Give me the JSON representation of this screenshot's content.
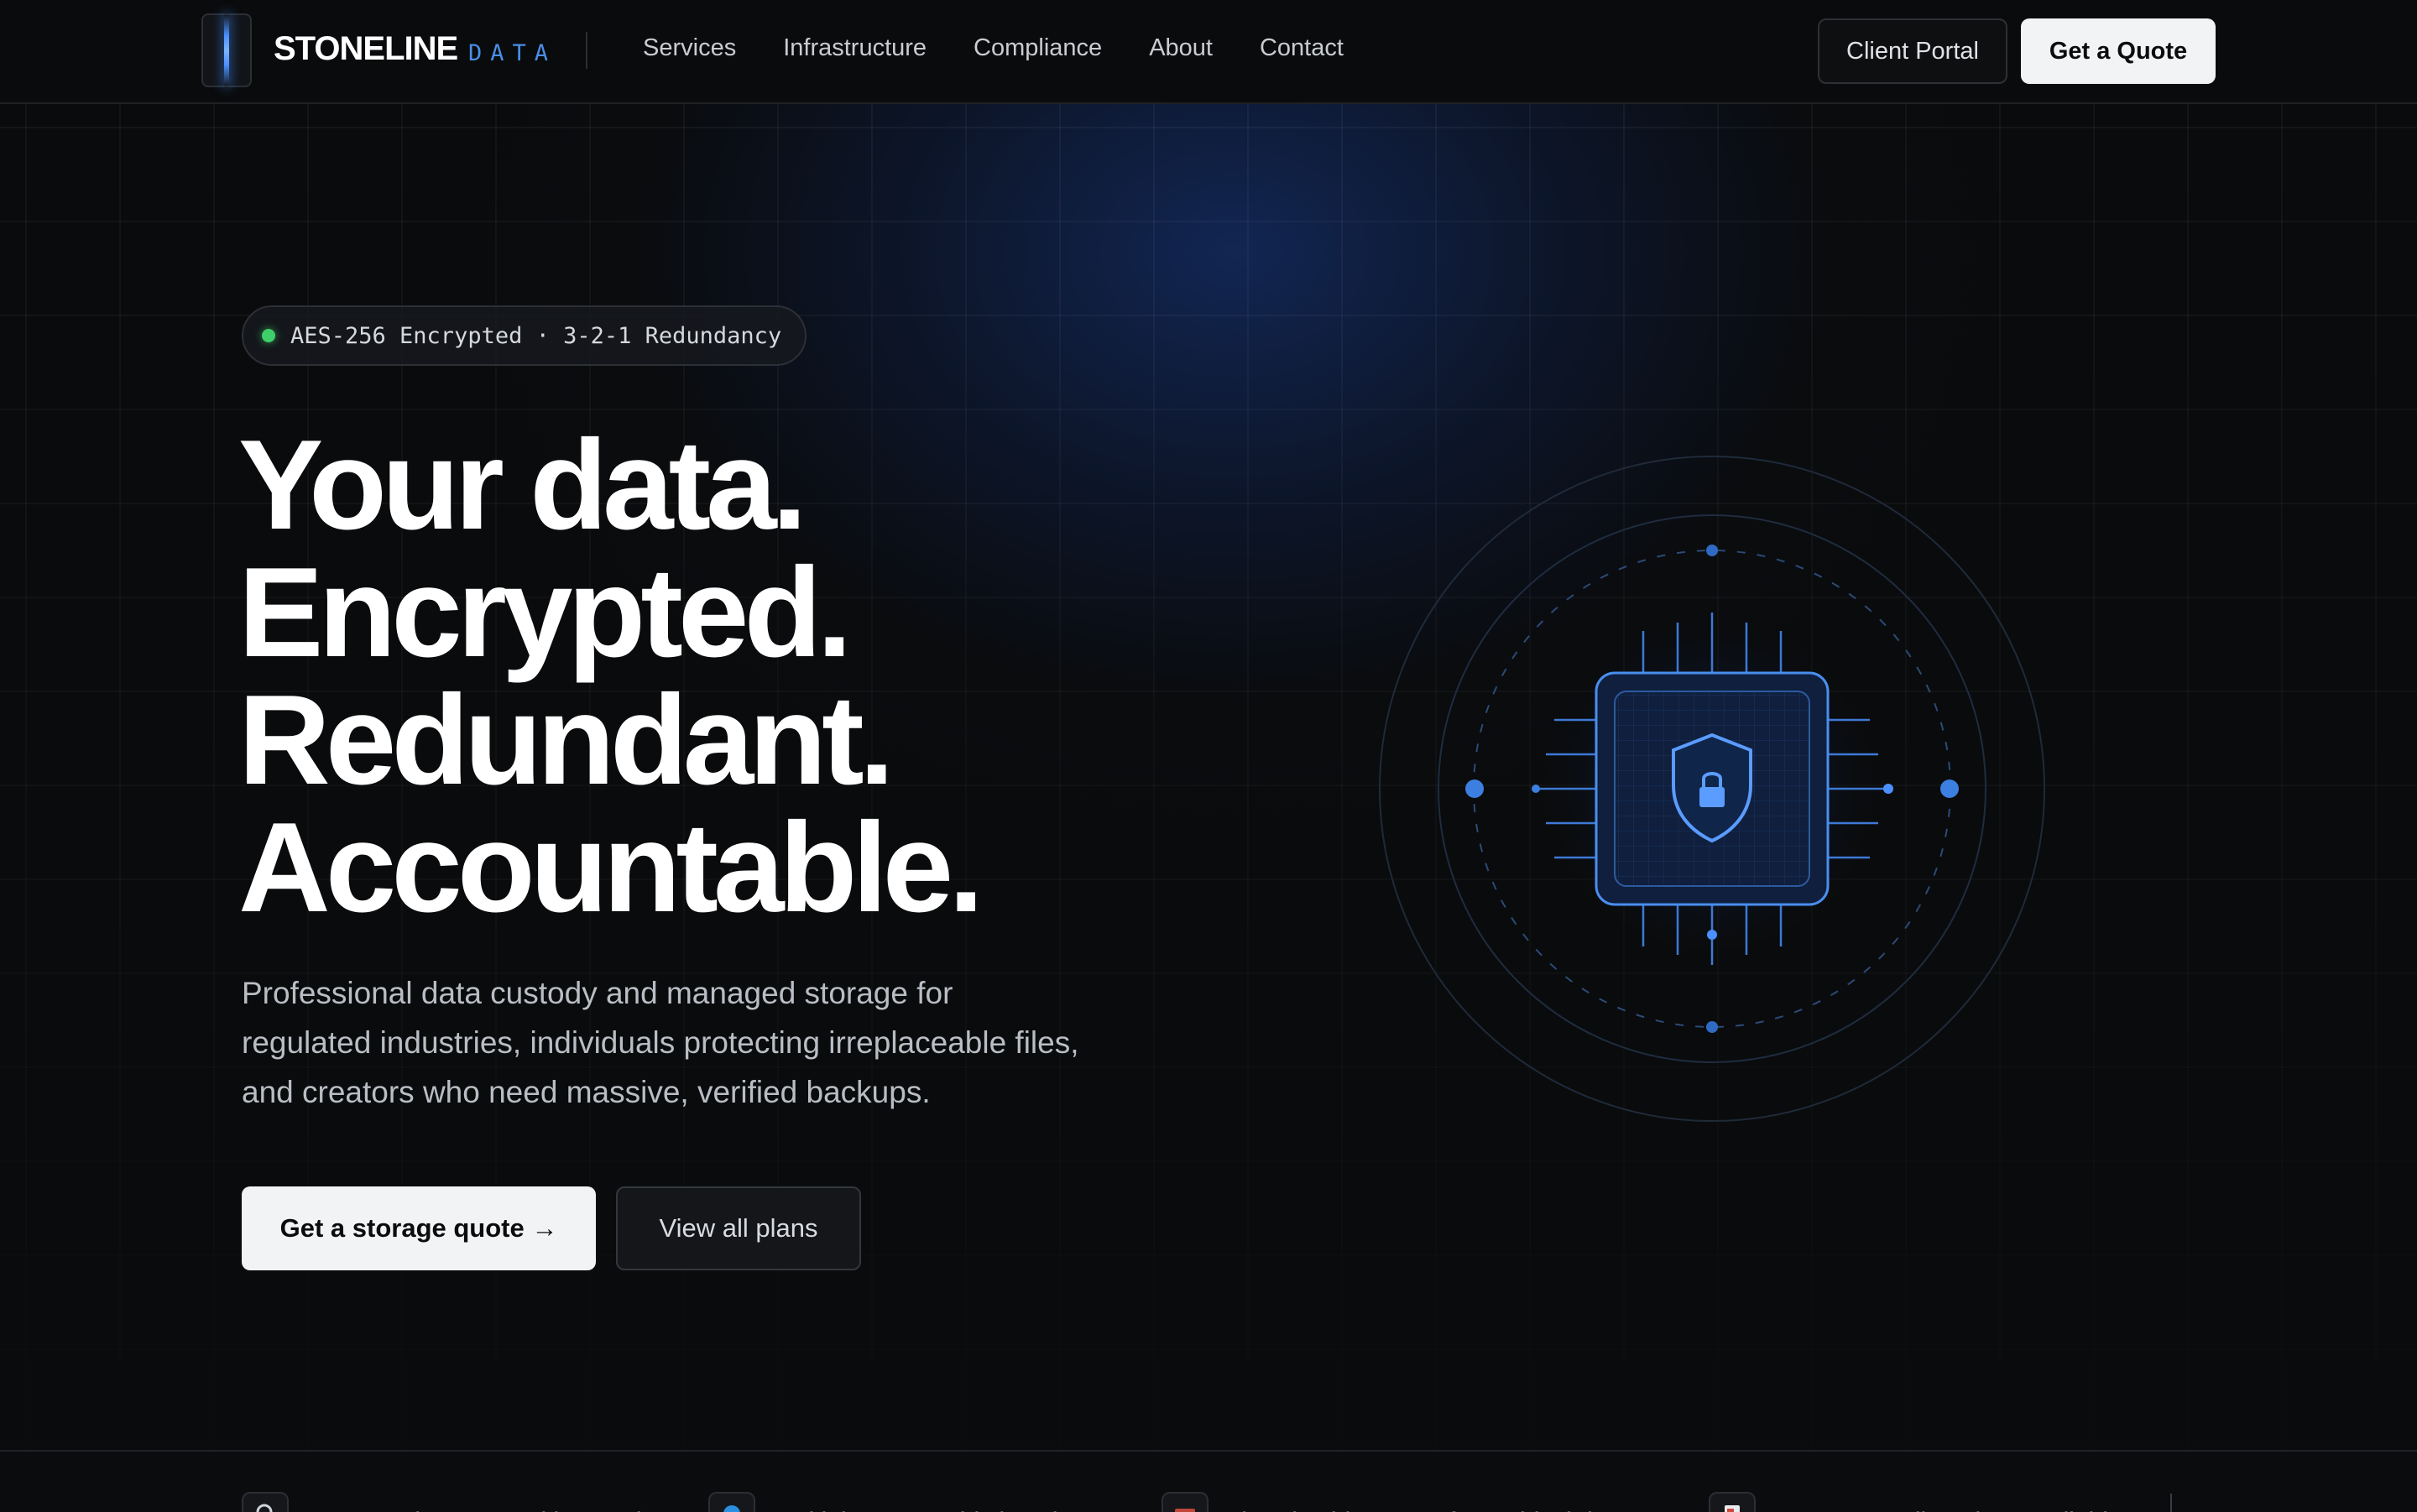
{
  "brand": {
    "name": "STONELINE",
    "sub": "DATA"
  },
  "nav": {
    "items": [
      {
        "label": "Services"
      },
      {
        "label": "Infrastructure"
      },
      {
        "label": "Compliance"
      },
      {
        "label": "About"
      },
      {
        "label": "Contact"
      }
    ],
    "client_portal": "Client Portal",
    "get_quote": "Get a Quote"
  },
  "hero": {
    "badge": "AES-256 Encrypted · 3-2-1 Redundancy",
    "headline": [
      "Your data.",
      "Encrypted.",
      "Redundant.",
      "Accountable."
    ],
    "subtext": "Professional data custody and managed storage for regulated industries, individuals protecting irreplaceable files, and creators who need massive, verified backups.",
    "cta_primary": "Get a storage quote →",
    "cta_secondary": "View all plans"
  },
  "features": [
    {
      "icon": "search-icon",
      "text": "Encrypted at rest and in transit"
    },
    {
      "icon": "globe-icon",
      "text": "Multiple geographic locations"
    },
    {
      "icon": "folder-icon",
      "text": "Tiered cold storage for archival data"
    },
    {
      "icon": "document-icon",
      "text": "HIPAA compliant tiers available"
    }
  ],
  "colors": {
    "accent": "#4a8ee8",
    "status_green": "#3ecf6a",
    "background": "#0a0b0c"
  }
}
